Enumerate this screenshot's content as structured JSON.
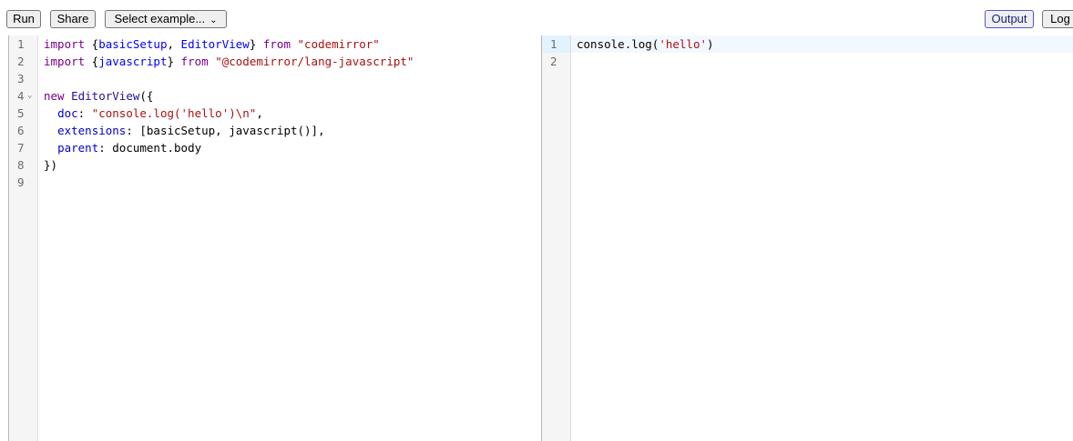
{
  "toolbar": {
    "run": "Run",
    "share": "Share",
    "select_example": "Select example...",
    "select_caret": "⌄",
    "output": "Output",
    "log": "Log"
  },
  "left_editor": {
    "gutter": [
      "1",
      "2",
      "3",
      "4",
      "5",
      "6",
      "7",
      "8",
      "9"
    ],
    "fold_marker": "⌄",
    "lines": [
      [
        {
          "t": "import",
          "c": "kw"
        },
        {
          "t": " {",
          "c": "plain"
        },
        {
          "t": "basicSetup",
          "c": "def"
        },
        {
          "t": ", ",
          "c": "plain"
        },
        {
          "t": "EditorView",
          "c": "def"
        },
        {
          "t": "} ",
          "c": "plain"
        },
        {
          "t": "from",
          "c": "kw"
        },
        {
          "t": " ",
          "c": "plain"
        },
        {
          "t": "\"codemirror\"",
          "c": "str"
        }
      ],
      [
        {
          "t": "import",
          "c": "kw"
        },
        {
          "t": " {",
          "c": "plain"
        },
        {
          "t": "javascript",
          "c": "def"
        },
        {
          "t": "} ",
          "c": "plain"
        },
        {
          "t": "from",
          "c": "kw"
        },
        {
          "t": " ",
          "c": "plain"
        },
        {
          "t": "\"@codemirror/lang-javascript\"",
          "c": "str"
        }
      ],
      [],
      [
        {
          "t": "new",
          "c": "kw"
        },
        {
          "t": " ",
          "c": "plain"
        },
        {
          "t": "EditorView",
          "c": "var"
        },
        {
          "t": "({",
          "c": "plain"
        }
      ],
      [
        {
          "t": "  ",
          "c": "plain"
        },
        {
          "t": "doc",
          "c": "prop"
        },
        {
          "t": ": ",
          "c": "plain"
        },
        {
          "t": "\"console.log('hello')\\n\"",
          "c": "str"
        },
        {
          "t": ",",
          "c": "plain"
        }
      ],
      [
        {
          "t": "  ",
          "c": "plain"
        },
        {
          "t": "extensions",
          "c": "prop"
        },
        {
          "t": ": [",
          "c": "plain"
        },
        {
          "t": "basicSetup",
          "c": "plain"
        },
        {
          "t": ", ",
          "c": "plain"
        },
        {
          "t": "javascript",
          "c": "plain"
        },
        {
          "t": "()],",
          "c": "plain"
        }
      ],
      [
        {
          "t": "  ",
          "c": "plain"
        },
        {
          "t": "parent",
          "c": "prop"
        },
        {
          "t": ": ",
          "c": "plain"
        },
        {
          "t": "document",
          "c": "plain"
        },
        {
          "t": ".",
          "c": "plain"
        },
        {
          "t": "body",
          "c": "plain"
        }
      ],
      [
        {
          "t": "})",
          "c": "plain"
        }
      ],
      []
    ]
  },
  "right_editor": {
    "gutter": [
      "1",
      "2"
    ],
    "lines": [
      [
        {
          "t": "console",
          "c": "plain"
        },
        {
          "t": ".",
          "c": "plain"
        },
        {
          "t": "log",
          "c": "plain"
        },
        {
          "t": "(",
          "c": "plain"
        },
        {
          "t": "'hello'",
          "c": "str"
        },
        {
          "t": ")",
          "c": "plain"
        }
      ],
      []
    ]
  }
}
